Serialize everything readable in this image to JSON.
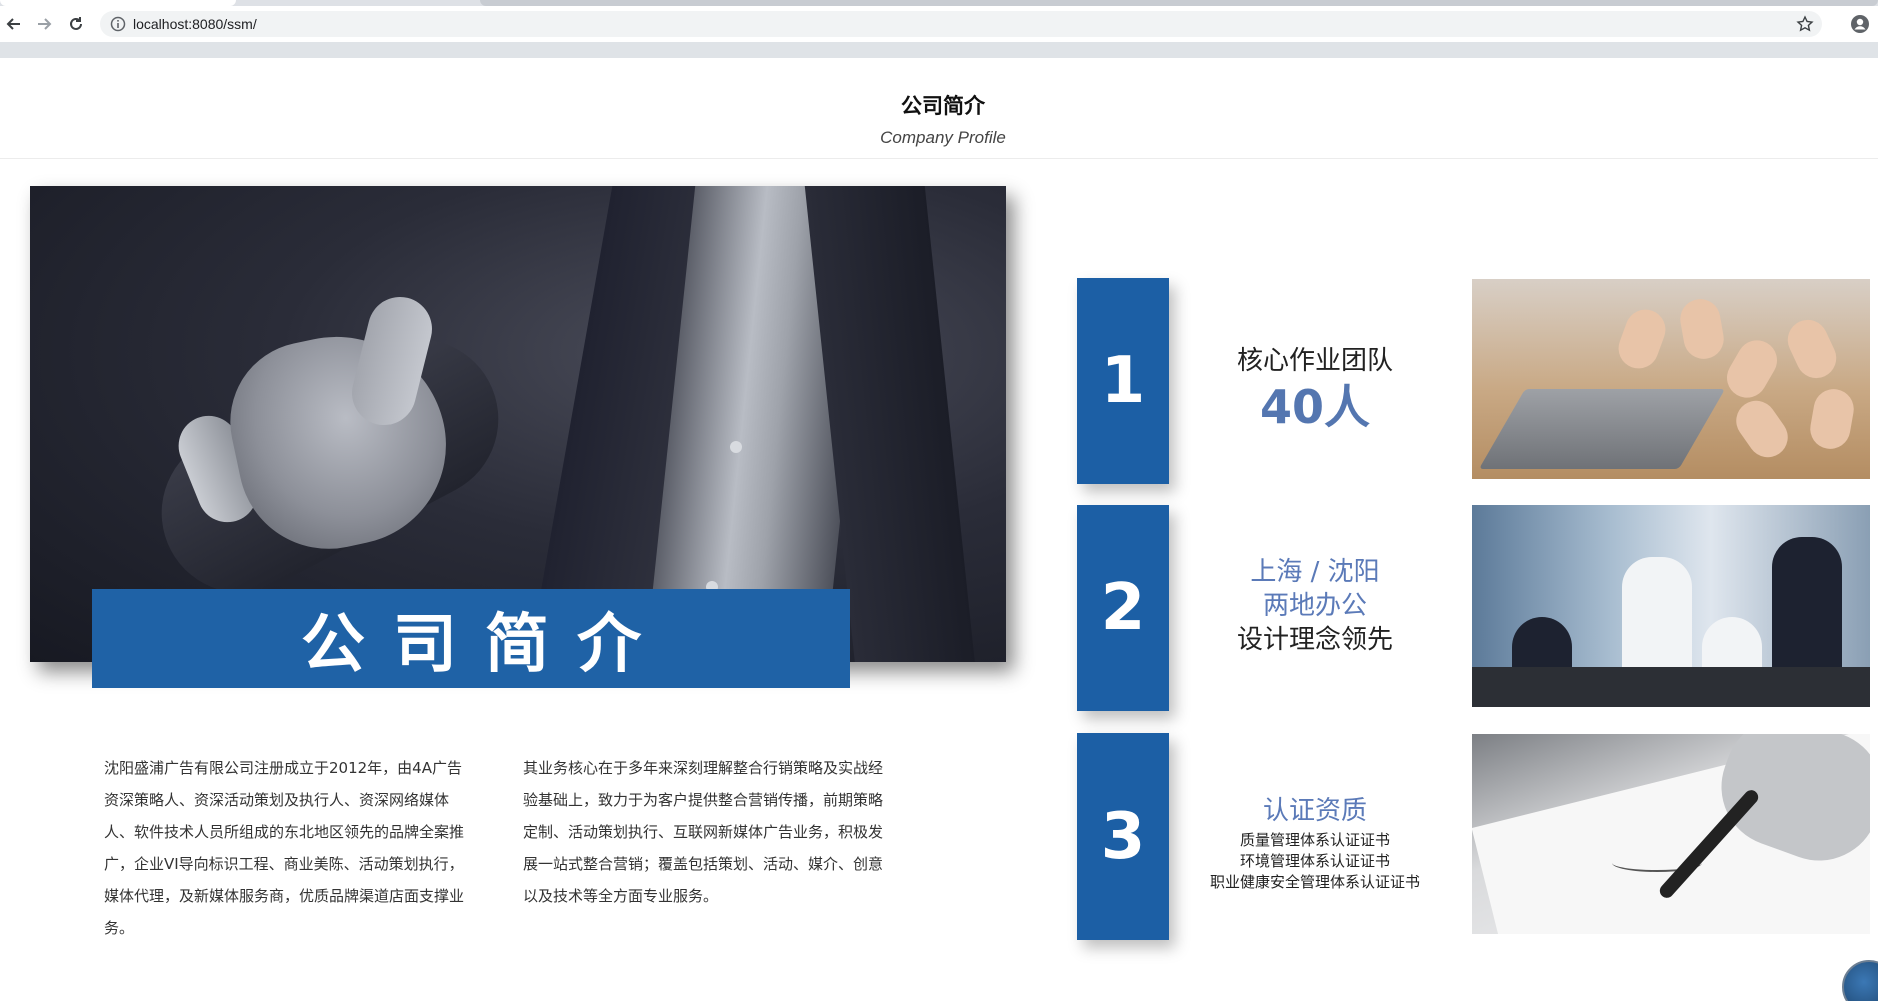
{
  "browser": {
    "url": "localhost:8080/ssm/"
  },
  "page": {
    "title": "公司简介",
    "subtitle": "Company Profile",
    "hero_banner": "公司简介",
    "intro": {
      "col1": "沈阳盛浦广告有限公司注册成立于2012年，由4A广告资深策略人、资深活动策划及执行人、资深网络媒体人、软件技术人员所组成的东北地区领先的品牌全案推广，企业VI导向标识工程、商业美陈、活动策划执行，媒体代理，及新媒体服务商，优质品牌渠道店面支撑业务。",
      "col2": "其业务核心在于多年来深刻理解整合行销策略及实战经验基础上，致力于为客户提供整合营销传播，前期策略定制、活动策划执行、互联网新媒体广告业务，积极发展一站式整合营销；覆盖包括策划、活动、媒介、创意以及技术等全方面专业服务。"
    },
    "features": [
      {
        "number": "1",
        "title": "核心作业团队",
        "value": "40人"
      },
      {
        "number": "2",
        "line1": "上海 / 沈阳",
        "line2": "两地办公",
        "line3": "设计理念领先"
      },
      {
        "number": "3",
        "title": "认证资质",
        "certs": [
          "质量管理体系认证证书",
          "环境管理体系认证证书",
          "职业健康安全管理体系认证证书"
        ]
      }
    ]
  },
  "colors": {
    "brand_blue": "#1f62a6",
    "accent_blue": "#5b7ab8"
  },
  "icons": [
    "back-arrow-icon",
    "forward-arrow-icon",
    "reload-icon",
    "info-icon",
    "star-icon",
    "profile-icon"
  ]
}
